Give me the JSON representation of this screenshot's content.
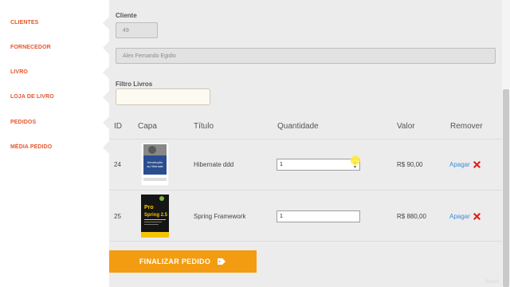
{
  "sidebar": {
    "items": [
      {
        "label": "CLIENTES"
      },
      {
        "label": "FORNECEDOR"
      },
      {
        "label": "LIVRO"
      },
      {
        "label": "LOJA DE LIVRO"
      },
      {
        "label": "PEDIDOS"
      },
      {
        "label": "MÉDIA PEDIDO"
      }
    ],
    "accent_color": "#e4572e"
  },
  "form": {
    "cliente_label": "Cliente",
    "cliente_id": "49",
    "cliente_nome": "Alex Fernando Egidio",
    "filtro_label": "Filtro Livros",
    "filtro_value": ""
  },
  "table": {
    "headers": {
      "id": "ID",
      "capa": "Capa",
      "titulo": "Título",
      "quantidade": "Quantidade",
      "valor": "Valor",
      "remover": "Remover"
    },
    "rows": [
      {
        "id": "24",
        "titulo": "Hibernate ddd",
        "quantidade": "1",
        "valor": "R$ 90,00",
        "remover": "Apagar",
        "cover_title": "Introdução ao Hibernate"
      },
      {
        "id": "25",
        "titulo": "Spring Framework",
        "quantidade": "1",
        "valor": "R$ 880,00",
        "remover": "Apagar",
        "cover_title": "Pro Spring 2.5"
      }
    ]
  },
  "actions": {
    "finalizar_label": "FINALIZAR PEDIDO",
    "finalizar_color": "#f39c12"
  },
  "watermark": "Bloom"
}
